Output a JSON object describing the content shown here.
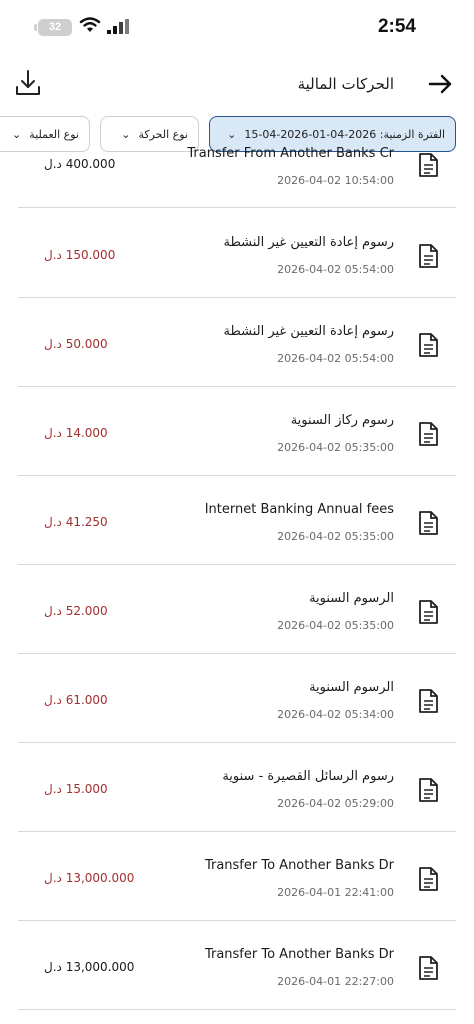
{
  "status_bar": {
    "time": "2:54",
    "battery": "32"
  },
  "header": {
    "title": "الحركات المالية"
  },
  "filters": {
    "period": "الفترة الزمنية: 2026-04-01-2026-04-15",
    "movement_type": "نوع الحركة",
    "operation_type": "نوع العملية"
  },
  "transactions": [
    {
      "title": "Transfer From Another Banks Cr",
      "time": "2026-04-02 10:54:00",
      "amount": "400.000 د.ل",
      "kind": "credit"
    },
    {
      "title": "رسوم إعادة التعيين غير النشطة",
      "time": "2026-04-02 05:54:00",
      "amount": "150.000 د.ل",
      "kind": "debit"
    },
    {
      "title": "رسوم إعادة التعيين غير النشطة",
      "time": "2026-04-02 05:54:00",
      "amount": "50.000 د.ل",
      "kind": "debit"
    },
    {
      "title": "رسوم ركاز السنوية",
      "time": "2026-04-02 05:35:00",
      "amount": "14.000 د.ل",
      "kind": "debit"
    },
    {
      "title": "Internet Banking Annual fees",
      "time": "2026-04-02 05:35:00",
      "amount": "41.250 د.ل",
      "kind": "debit"
    },
    {
      "title": "الرسوم السنوية",
      "time": "2026-04-02 05:35:00",
      "amount": "52.000 د.ل",
      "kind": "debit"
    },
    {
      "title": "الرسوم السنوية",
      "time": "2026-04-02 05:34:00",
      "amount": "61.000 د.ل",
      "kind": "debit"
    },
    {
      "title": "رسوم الرسائل القصيرة - سنوية",
      "time": "2026-04-02 05:29:00",
      "amount": "15.000 د.ل",
      "kind": "debit"
    },
    {
      "title": "Transfer To Another Banks Dr",
      "time": "2026-04-01 22:41:00",
      "amount": "13,000.000 د.ل",
      "kind": "debit"
    },
    {
      "title": "Transfer To Another Banks Dr",
      "time": "2026-04-01 22:27:00",
      "amount": "13,000.000 د.ل",
      "kind": "credit"
    }
  ]
}
